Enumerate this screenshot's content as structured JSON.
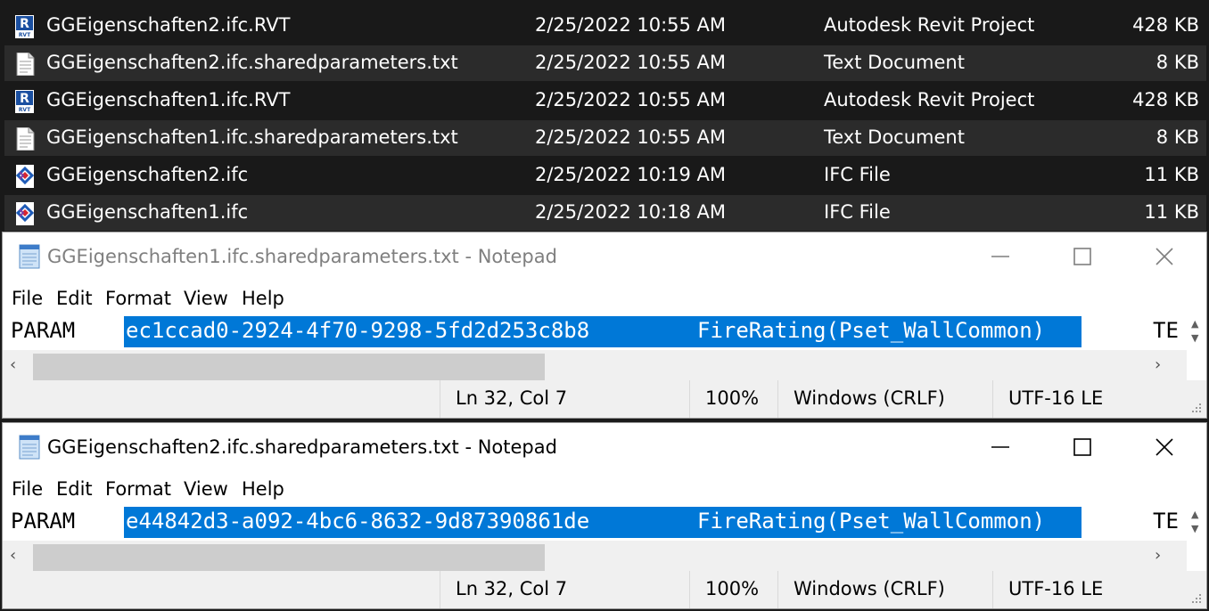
{
  "explorer": {
    "files": [
      {
        "icon": "revit-file-icon",
        "name": "GGEigenschaften2.ifc.RVT",
        "date": "2/25/2022 10:55 AM",
        "type": "Autodesk Revit Project",
        "size": "428 KB"
      },
      {
        "icon": "text-file-icon",
        "name": "GGEigenschaften2.ifc.sharedparameters.txt",
        "date": "2/25/2022 10:55 AM",
        "type": "Text Document",
        "size": "8 KB"
      },
      {
        "icon": "revit-file-icon",
        "name": "GGEigenschaften1.ifc.RVT",
        "date": "2/25/2022 10:55 AM",
        "type": "Autodesk Revit Project",
        "size": "428 KB"
      },
      {
        "icon": "text-file-icon",
        "name": "GGEigenschaften1.ifc.sharedparameters.txt",
        "date": "2/25/2022 10:55 AM",
        "type": "Text Document",
        "size": "8 KB"
      },
      {
        "icon": "ifc-file-icon",
        "name": "GGEigenschaften2.ifc",
        "date": "2/25/2022 10:19 AM",
        "type": "IFC File",
        "size": "11 KB"
      },
      {
        "icon": "ifc-file-icon",
        "name": "GGEigenschaften1.ifc",
        "date": "2/25/2022 10:18 AM",
        "type": "IFC File",
        "size": "11 KB"
      }
    ],
    "icons": {
      "revit_letter": "R",
      "revit_sub": "RVT"
    }
  },
  "notepad1": {
    "title": "GGEigenschaften1.ifc.sharedparameters.txt - Notepad",
    "state": "inactive",
    "menu": [
      "File",
      "Edit",
      "Format",
      "View",
      "Help"
    ],
    "line_keyword": "PARAM",
    "line_guid": "ec1ccad0-2924-4f70-9298-5fd2d253c8b8",
    "line_name": "FireRating(Pset_WallCommon)",
    "line_tail": "TE",
    "status": {
      "position": "Ln 32, Col 7",
      "zoom": "100%",
      "line_ending": "Windows (CRLF)",
      "encoding": "UTF-16 LE"
    }
  },
  "notepad2": {
    "title": "GGEigenschaften2.ifc.sharedparameters.txt - Notepad",
    "state": "active",
    "menu": [
      "File",
      "Edit",
      "Format",
      "View",
      "Help"
    ],
    "line_keyword": "PARAM",
    "line_guid": "e44842d3-a092-4bc6-8632-9d87390861de",
    "line_name": "FireRating(Pset_WallCommon)",
    "line_tail": "TE",
    "status": {
      "position": "Ln 32, Col 7",
      "zoom": "100%",
      "line_ending": "Windows (CRLF)",
      "encoding": "UTF-16 LE"
    }
  },
  "colors": {
    "selection": "#0078d7",
    "explorer_bg": "#191919",
    "row_highlight": "#2b2b2b"
  }
}
